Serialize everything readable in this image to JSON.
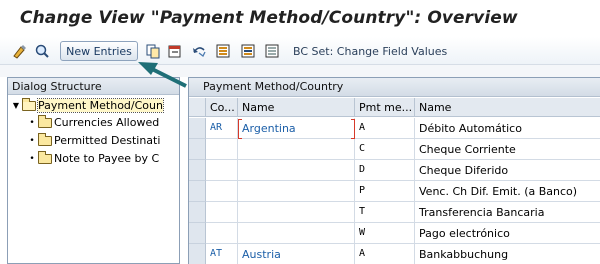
{
  "window": {
    "title": "Change View \"Payment Method/Country\": Overview"
  },
  "toolbar": {
    "icons": [
      "display-change-icon",
      "find-icon",
      "copy-icon",
      "delete-icon",
      "undo-icon",
      "select-all-icon",
      "select-block-icon",
      "deselect-all-icon"
    ],
    "new_entries_label": "New Entries",
    "bcset_label": "BC Set: Change Field Values"
  },
  "dialog_structure": {
    "header": "Dialog Structure",
    "items": [
      {
        "label": "Payment Method/Coun",
        "level": 0,
        "expanded": true,
        "selected": true
      },
      {
        "label": "Currencies Allowed",
        "level": 1
      },
      {
        "label": "Permitted Destinati",
        "level": 1
      },
      {
        "label": "Note to Payee by C",
        "level": 1
      }
    ]
  },
  "table": {
    "title": "Payment Method/Country",
    "columns": [
      "Co...",
      "Name",
      "Pmt me...",
      "Name"
    ],
    "rows": [
      {
        "country": "AR",
        "country_name": "Argentina",
        "method": "A",
        "method_name": "Débito Automático"
      },
      {
        "country": "",
        "country_name": "",
        "method": "C",
        "method_name": "Cheque Corriente"
      },
      {
        "country": "",
        "country_name": "",
        "method": "D",
        "method_name": "Cheque Diferido"
      },
      {
        "country": "",
        "country_name": "",
        "method": "P",
        "method_name": "Venc. Ch Dif. Emit.  (a Banco)"
      },
      {
        "country": "",
        "country_name": "",
        "method": "T",
        "method_name": "Transferencia Bancaria"
      },
      {
        "country": "",
        "country_name": "",
        "method": "W",
        "method_name": "Pago electrónico"
      },
      {
        "country": "AT",
        "country_name": "Austria",
        "method": "A",
        "method_name": "Bankabbuchung"
      }
    ]
  },
  "colors": {
    "accent_blue": "#1c5fa8",
    "callout_arrow": "#1f6f77",
    "focus_red": "#d63a2a"
  }
}
